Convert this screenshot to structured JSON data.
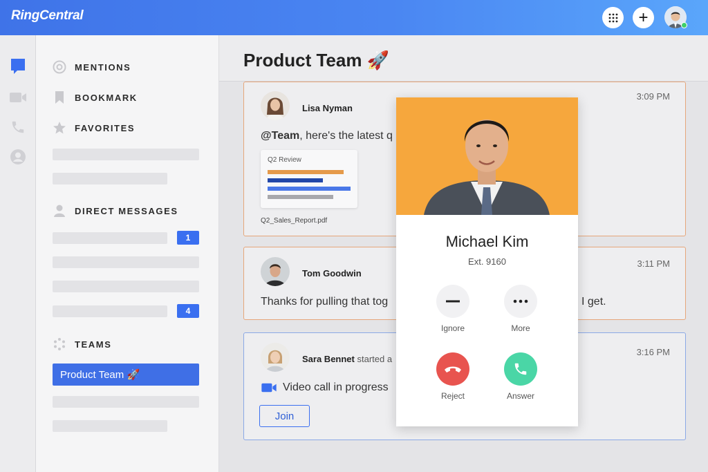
{
  "app": {
    "logo": "RingCentral",
    "top_actions": {
      "dialpad_icon": "dialpad-icon",
      "add_label": "+",
      "avatar_status": "online"
    }
  },
  "rail": {
    "items": [
      {
        "name": "messages",
        "icon": "chat-icon",
        "active": true
      },
      {
        "name": "video",
        "icon": "video-icon"
      },
      {
        "name": "phone",
        "icon": "phone-icon"
      },
      {
        "name": "contacts",
        "icon": "contact-icon"
      }
    ]
  },
  "sidebar": {
    "mentions": "MENTIONS",
    "bookmark": "BOOKMARK",
    "favorites": "FAVORITES",
    "direct_messages": "DIRECT MESSAGES",
    "dm_badges": [
      "1",
      "4"
    ],
    "teams": "TEAMS",
    "active_team": "Product Team 🚀"
  },
  "main": {
    "title": "Product Team 🚀",
    "messages": [
      {
        "sender": "Lisa Nyman",
        "time": "3:09 PM",
        "mention": "@Team",
        "text": ", here's the latest q",
        "attachment": {
          "title": "Q2 Review",
          "file": "Q2_Sales_Report.pdf"
        }
      },
      {
        "sender": "Tom Goodwin",
        "time": "3:11 PM",
        "text": "Thanks for pulling that tog",
        "text_tail": "I get."
      },
      {
        "sender": "Sara Bennet",
        "action": "started a",
        "time": "3:16 PM",
        "text": "Video call in progress",
        "button": "Join"
      }
    ]
  },
  "call": {
    "name": "Michael Kim",
    "ext": "Ext. 9160",
    "ignore": "Ignore",
    "more": "More",
    "reject": "Reject",
    "answer": "Answer",
    "colors": {
      "reject": "#e8544f",
      "answer": "#4ad6a6",
      "photo_bg": "#f6a73d"
    }
  }
}
